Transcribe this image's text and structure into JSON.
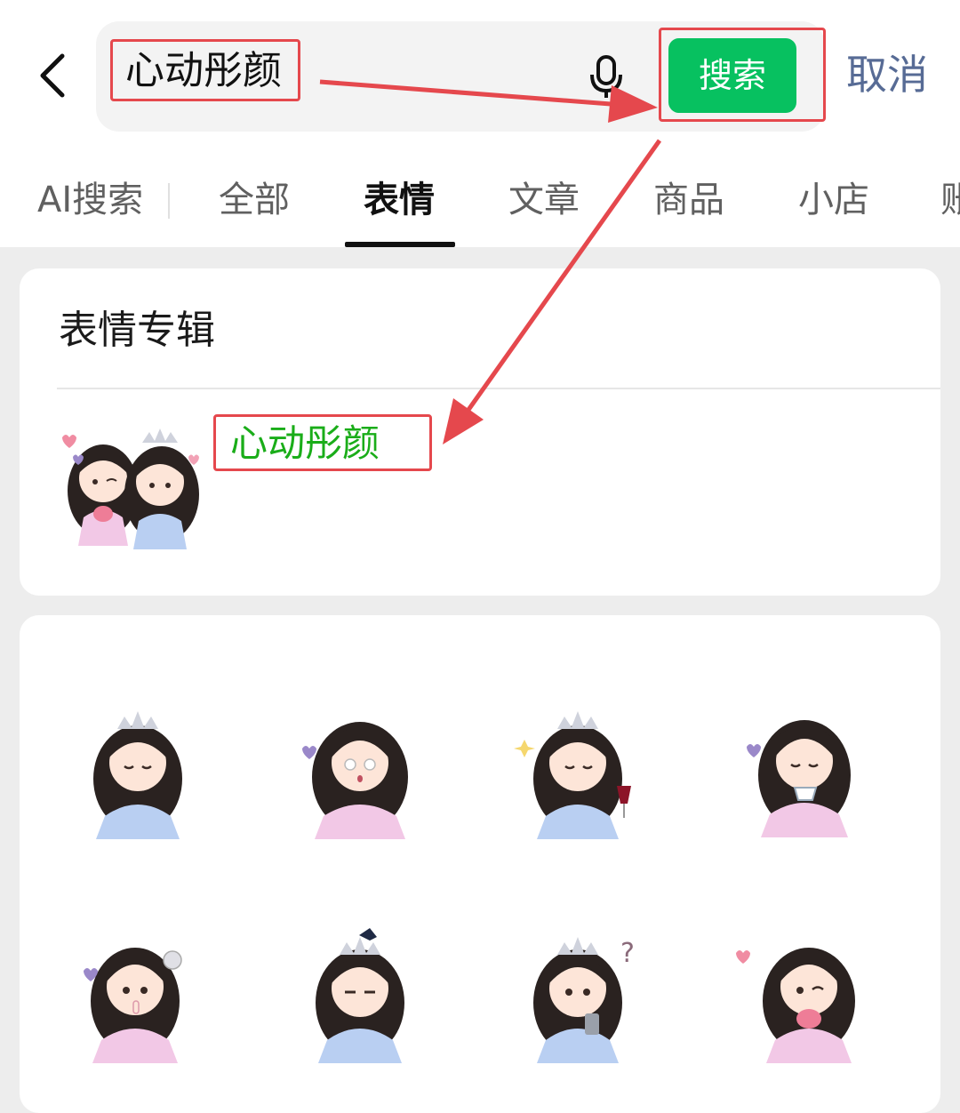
{
  "search": {
    "query": "心动彤颜",
    "button_label": "搜索",
    "cancel_label": "取消"
  },
  "tabs": [
    {
      "label": "AI搜索"
    },
    {
      "label": "全部"
    },
    {
      "label": "表情",
      "active": true
    },
    {
      "label": "文章"
    },
    {
      "label": "商品"
    },
    {
      "label": "小店"
    },
    {
      "label": "账"
    }
  ],
  "album_section": {
    "title": "表情专辑",
    "album_name": "心动彤颜"
  },
  "stickers": [
    {
      "pose": "eyes-closed-tiara"
    },
    {
      "pose": "blank-stare"
    },
    {
      "pose": "wine-glass-tiara"
    },
    {
      "pose": "teacup"
    },
    {
      "pose": "finger-to-lips"
    },
    {
      "pose": "crow-on-tiara"
    },
    {
      "pose": "question-phone"
    },
    {
      "pose": "wink-heart"
    }
  ],
  "colors": {
    "accent_green": "#07c160",
    "album_green": "#1aad19",
    "annotation_red": "#e5484d",
    "cancel_blue": "#576b95"
  }
}
